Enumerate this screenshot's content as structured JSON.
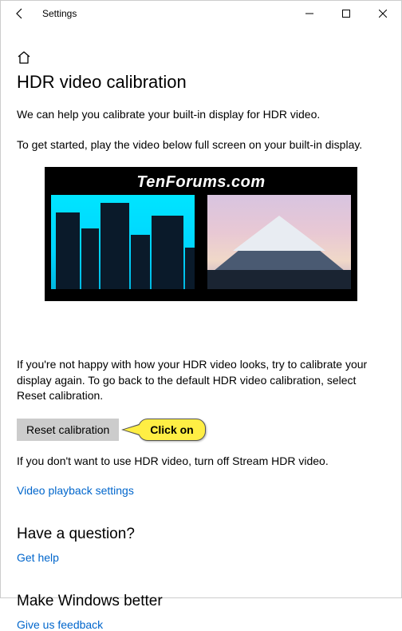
{
  "titlebar": {
    "title": "Settings"
  },
  "page": {
    "title": "HDR video calibration",
    "intro1": "We can help you calibrate your built-in display for HDR video.",
    "intro2": "To get started, play the video below full screen on your built-in display.",
    "watermark": "TenForums.com",
    "calibrate_text": "If you're not happy with how your HDR video looks, try to calibrate your display again. To go back to the default HDR video calibration, select Reset calibration.",
    "reset_button": "Reset calibration",
    "callout": "Click on",
    "turnoff_text": "If you don't want to use HDR video, turn off Stream HDR video.",
    "playback_link": "Video playback settings"
  },
  "question": {
    "heading": "Have a question?",
    "link": "Get help"
  },
  "feedback": {
    "heading": "Make Windows better",
    "link": "Give us feedback"
  }
}
